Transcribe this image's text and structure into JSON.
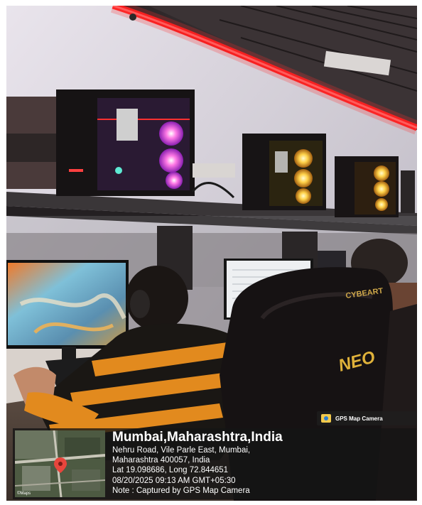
{
  "badge": {
    "label": "GPS Map Camera",
    "icon": "camera-icon"
  },
  "location": {
    "title": "Mumbai,Maharashtra,India",
    "address_line1": "Nehru Road, Vile Parle East, Mumbai,",
    "address_line2": "Maharashtra 400057, India",
    "coordinates": "Lat 19.098686, Long 72.844651",
    "datetime": "08/20/2025 09:13 AM GMT+05:30",
    "note": "Note : Captured by GPS Map Camera"
  },
  "map": {
    "credit": "©Maps",
    "pin_color": "#e8453c"
  },
  "photo": {
    "chair_brand": "CYBEART",
    "chair_logo": "NEO",
    "accent_color": "#ff1a1a"
  }
}
